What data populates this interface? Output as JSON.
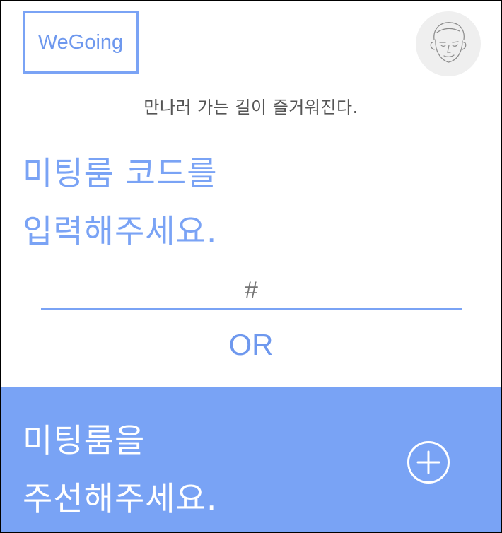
{
  "header": {
    "logo_text": "WeGoing",
    "avatar_icon": "user-avatar-sketch-icon"
  },
  "tagline": "만나러 가는 길이 즐거워진다.",
  "join": {
    "heading_line1": "미팅룸 코드를",
    "heading_line2": "입력해주세요.",
    "code_placeholder": "#"
  },
  "divider_label": "OR",
  "create": {
    "line1": "미팅룸을",
    "line2": "주선해주세요.",
    "plus_icon": "plus-circle-icon"
  },
  "colors": {
    "accent": "#7aa3f5",
    "panel": "#79a3f5",
    "tagline": "#555555"
  }
}
